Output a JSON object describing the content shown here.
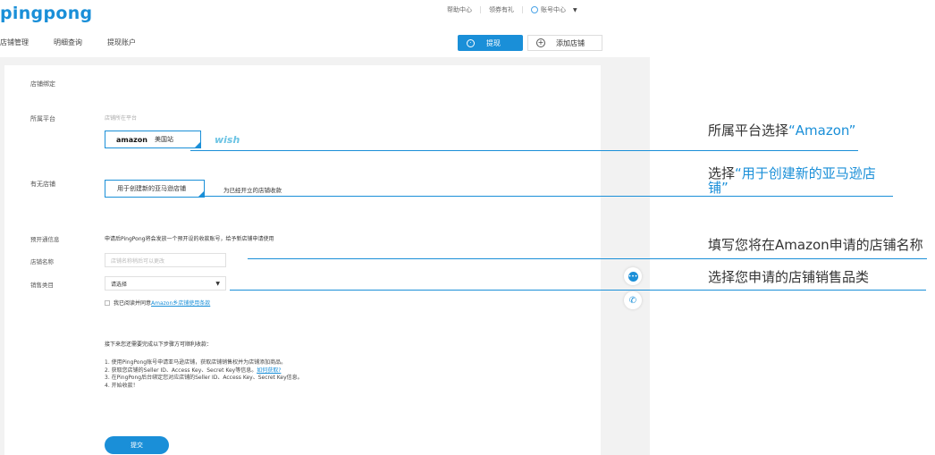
{
  "header": {
    "logo": "pingpong",
    "links": [
      "帮助中心",
      "领券有礼",
      "账号中心"
    ],
    "nav": [
      "店铺管理",
      "明细查询",
      "提现账户"
    ],
    "withdraw_button": "提现",
    "add_store_button": "添加店铺"
  },
  "form": {
    "section_title": "店铺绑定",
    "platform_label": "所属平台",
    "platform_hint": "店铺所在平台",
    "platform_amazon_logo": "amazon",
    "platform_amazon_site": "美国站",
    "platform_wish_logo": "wish",
    "has_store_label": "有无店铺",
    "store_option_new": "用于创建新的亚马逊店铺",
    "store_option_existing": "为已经开立的店铺收款",
    "preopen_label": "预开通信息",
    "preopen_text": "申请后PingPong将会发放一个预开设的收款账号，给予新店铺申请使用",
    "store_name_label": "店铺名称",
    "store_name_placeholder": "店铺名称稍后可以更改",
    "category_label": "销售类目",
    "category_value": "请选择",
    "agree_text": "我已阅读并同意",
    "agree_link": "Amazon乡店铺使用条款",
    "steps_title": "接下来您还需要完成以下步骤方可顺利收款：",
    "steps": [
      "1. 使用PingPong账号申请亚马逊店铺，获取店铺销售权并为店铺添加商品。",
      "2. 获取您店铺的Seller ID、Access Key、Secret Key等信息。",
      "3. 在PingPong后台绑定您对应店铺的Seller ID、Access Key、Secret Key信息。",
      "4. 开始收款！"
    ],
    "steps_link": "如何获取?",
    "submit": "提交"
  },
  "annotations": {
    "a1_prefix": "所属平台选择",
    "a1_highlight": "“Amazon”",
    "a2_prefix": "选择",
    "a2_highlight": "“用于创建新的亚马逊店",
    "a2_line2": "铺”",
    "a3": "填写您将在Amazon申请的店铺名称",
    "a4": "选择您申请的店铺销售品类"
  },
  "colors": {
    "brand": "#1a8fd8"
  }
}
